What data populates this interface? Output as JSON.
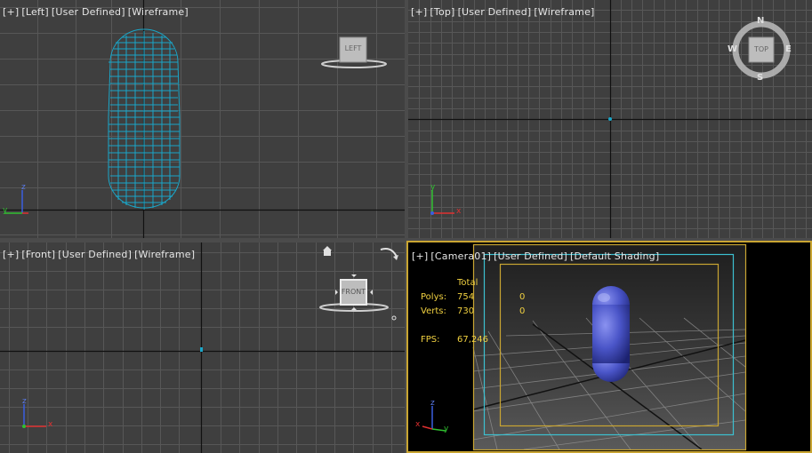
{
  "viewports": {
    "left": {
      "plus": "[+]",
      "view": "[Left]",
      "mode": "[User Defined]",
      "shading": "[Wireframe]",
      "cube_label": "LEFT"
    },
    "top": {
      "plus": "[+]",
      "view": "[Top]",
      "mode": "[User Defined]",
      "shading": "[Wireframe]",
      "cube_label": "TOP",
      "compass": {
        "n": "N",
        "e": "E",
        "s": "S",
        "w": "W"
      }
    },
    "front": {
      "plus": "[+]",
      "view": "[Front]",
      "mode": "[User Defined]",
      "shading": "[Wireframe]",
      "cube_label": "FRONT"
    },
    "camera": {
      "plus": "[+]",
      "view": "[Camera01]",
      "mode": "[User Defined]",
      "shading": "[Default Shading]"
    }
  },
  "stats": {
    "header": "Total",
    "polys_label": "Polys:",
    "polys_total": "754",
    "polys_sel": "0",
    "verts_label": "Verts:",
    "verts_total": "730",
    "verts_sel": "0",
    "fps_label": "FPS:",
    "fps_value": "67,246"
  },
  "axes": {
    "x": "x",
    "y": "y",
    "z": "z"
  },
  "colors": {
    "viewport_bg": "#3f3f3f",
    "grid": "#585858",
    "grid_main": "#111111",
    "wireframe": "#1aa6c8",
    "active_border": "#c9a532",
    "capsule": "#4a55c8",
    "safe_frame_outer": "#c9a532",
    "safe_frame_mid": "#3cc0d0",
    "stats_text": "#f0d040"
  }
}
